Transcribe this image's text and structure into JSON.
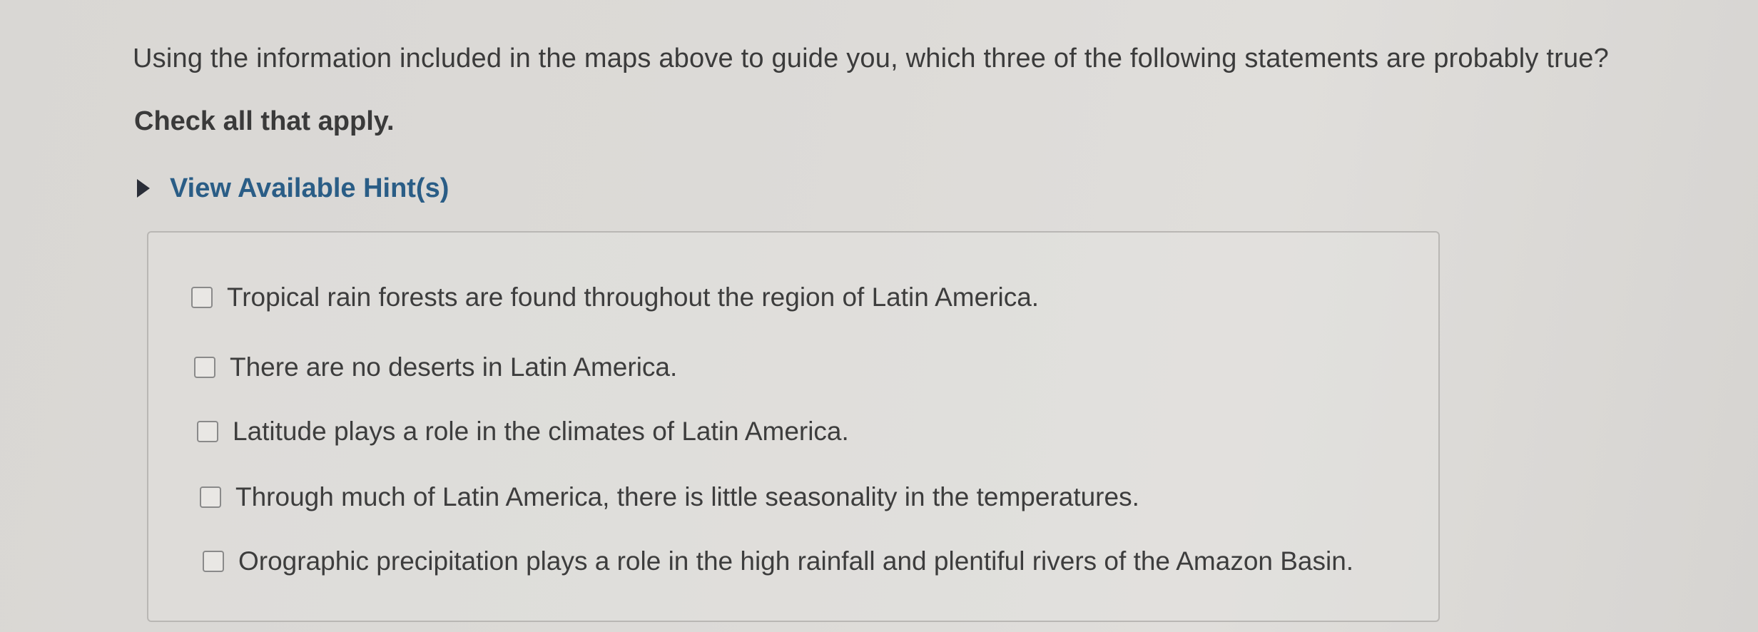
{
  "question": {
    "text": "Using the information included in the maps above to guide you, which three of the following statements are probably true?",
    "instruction": "Check all that apply."
  },
  "hints": {
    "label": "View Available Hint(s)"
  },
  "options": [
    {
      "label": "Tropical rain forests are found throughout the region of Latin America.",
      "checked": false
    },
    {
      "label": "There are no deserts in Latin America.",
      "checked": false
    },
    {
      "label": "Latitude plays a role in the climates of Latin America.",
      "checked": false
    },
    {
      "label": "Through much of Latin America, there is little seasonality in the temperatures.",
      "checked": false
    },
    {
      "label": "Orographic precipitation plays a role in the high rainfall and plentiful rivers of the Amazon Basin.",
      "checked": false
    }
  ]
}
